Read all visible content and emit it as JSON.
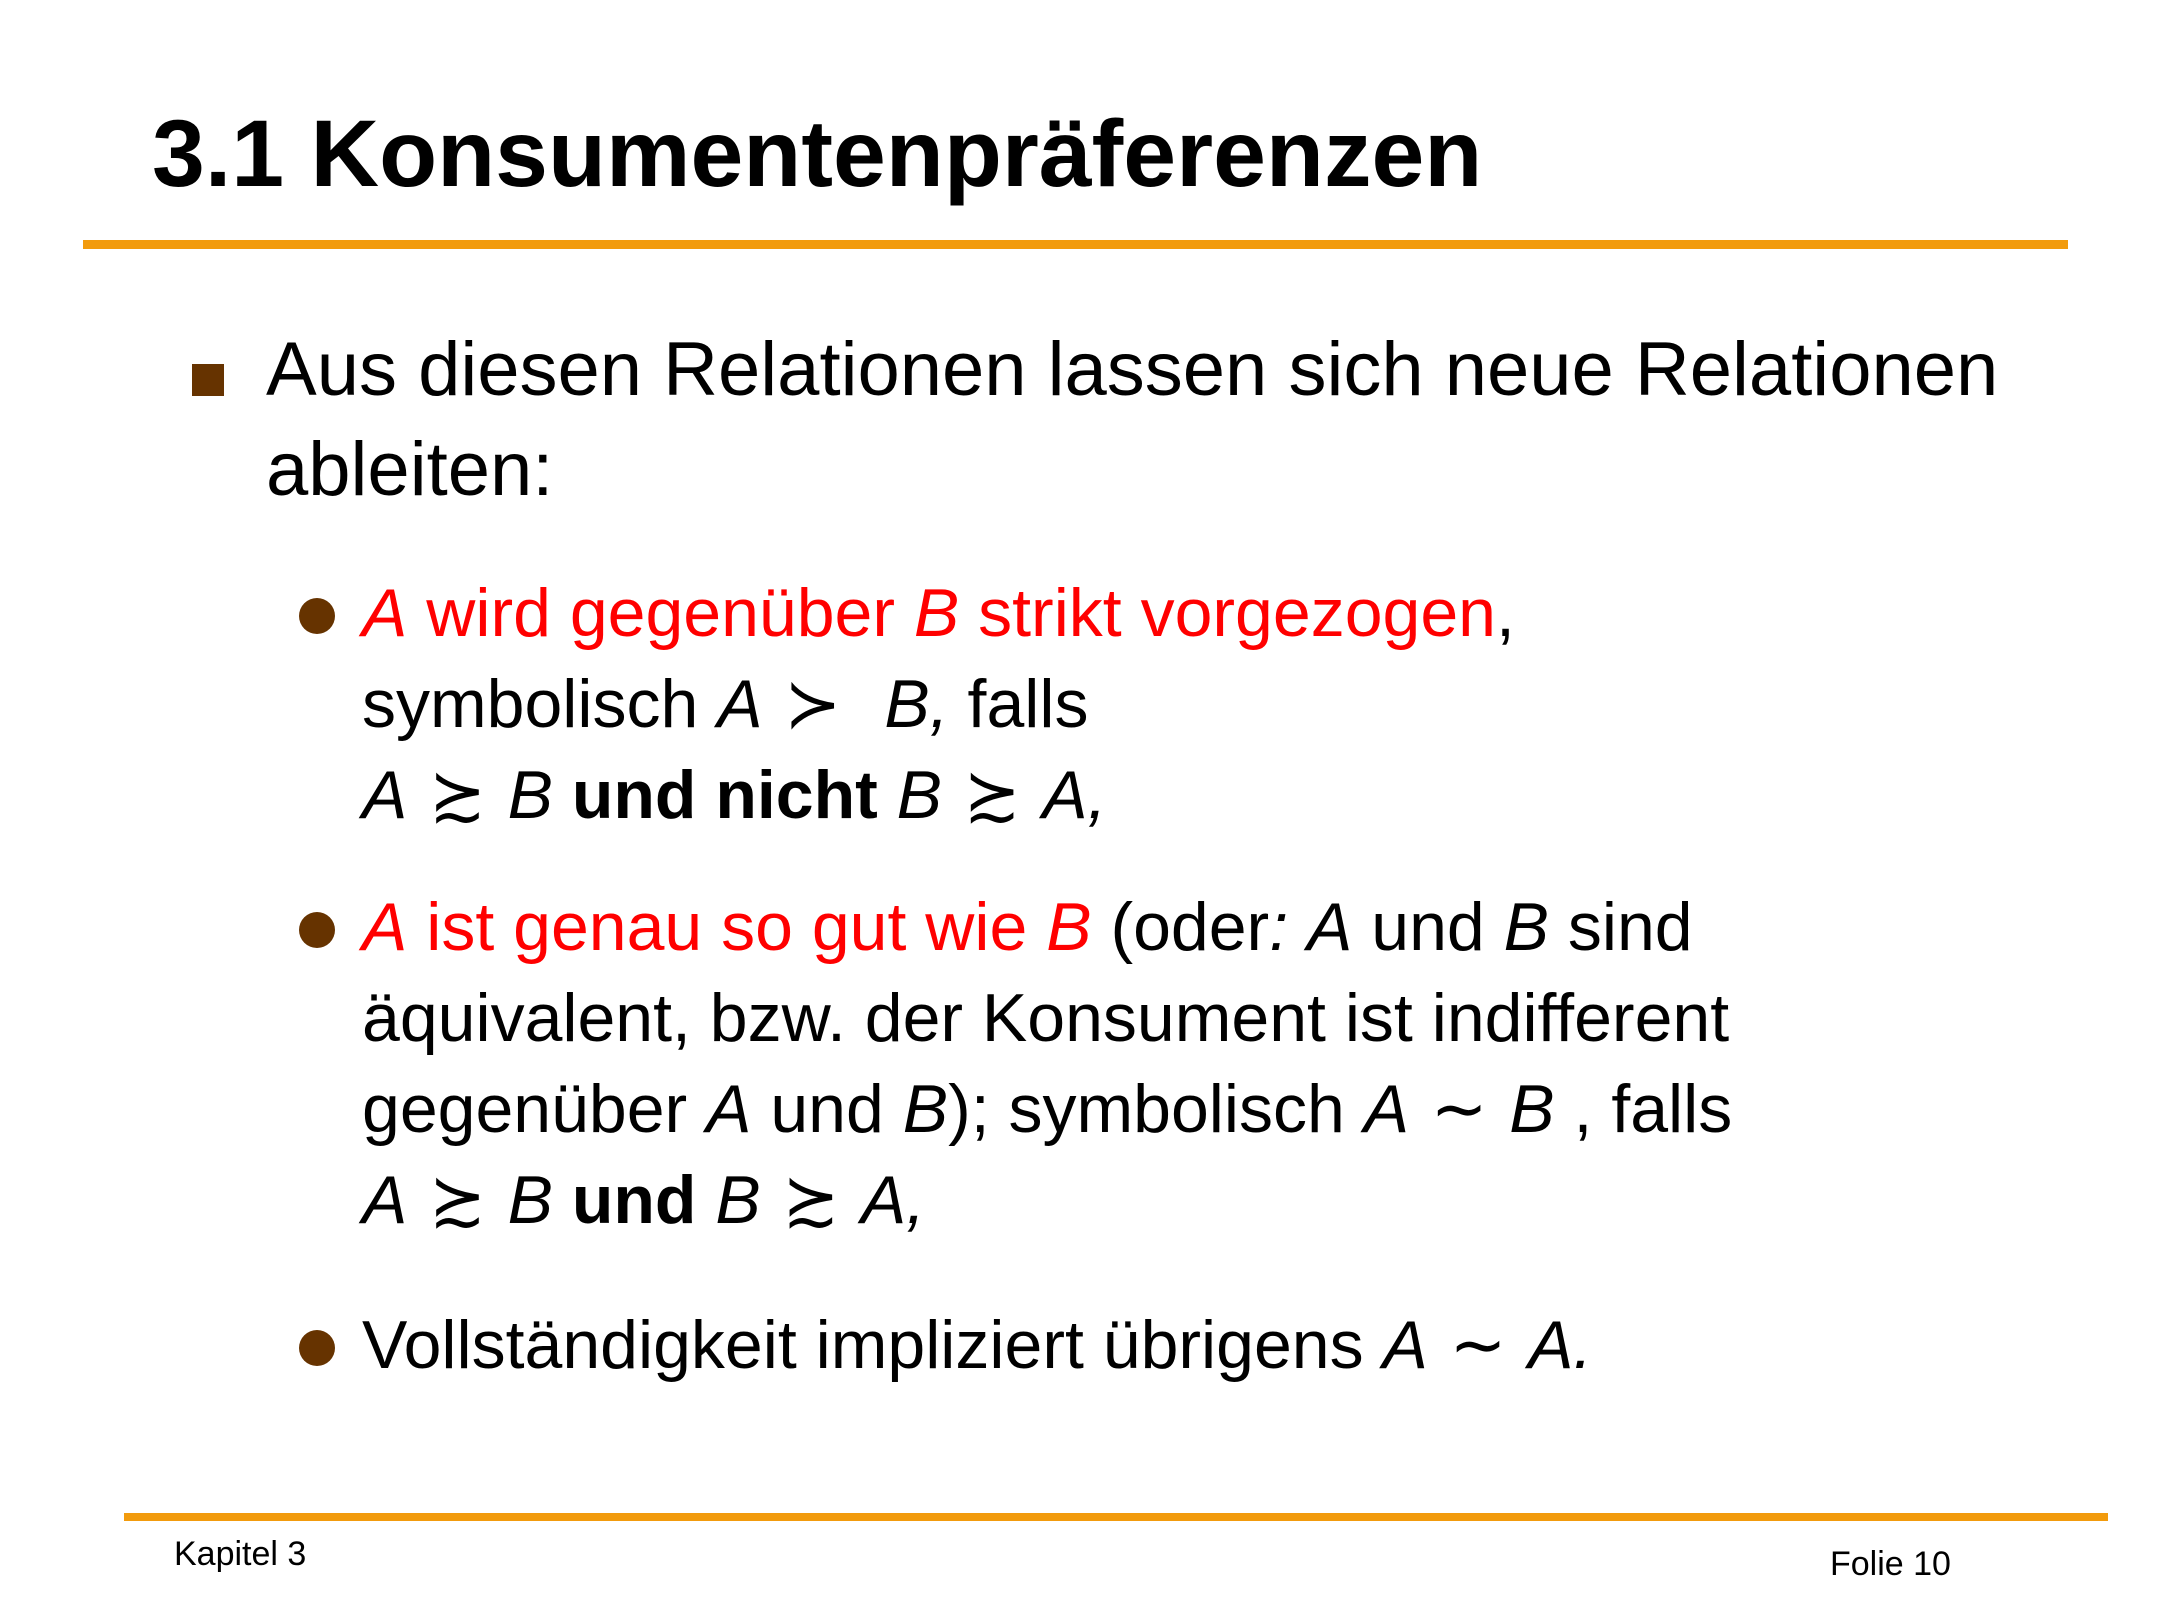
{
  "title": "3.1 Konsumentenpräferenzen",
  "colors": {
    "accent_rule": "#f29b0d",
    "bullet": "#663300",
    "highlight": "#ff0000"
  },
  "main_point": {
    "text": "Aus diesen Relationen lassen sich neue Relationen ableiten:"
  },
  "items": [
    {
      "headline": {
        "A": "A",
        "t1": " wird gegenüber ",
        "B": "B",
        "t2": " strikt vorgezogen",
        "comma": ","
      },
      "line2": {
        "t1": "symbolisch ",
        "A": "A",
        "rel": " ≻  ",
        "B": "B,",
        "t2": " falls"
      },
      "line3": {
        "A": "A",
        "rel1": " ≿ ",
        "B": "B",
        "bold": " und nicht ",
        "B2": "B",
        "rel2": " ≿ ",
        "A2": "A,"
      }
    },
    {
      "headline": {
        "A": "A",
        "t1": " ist genau so gut wie ",
        "B": "B",
        "t2": " (oder",
        "colon": ":",
        "space": " ",
        "A2": "A",
        "t3": " und ",
        "B2": "B",
        "t4": " sind"
      },
      "line2": {
        "text": "äquivalent, bzw. der Konsument ist indifferent"
      },
      "line3": {
        "t1": "gegenüber ",
        "A": "A",
        "t2": " und ",
        "B": "B",
        "t3": "); symbolisch ",
        "A2": "A",
        "rel": " ∼ ",
        "B2": "B",
        "t4": " , falls"
      },
      "line4": {
        "A": "A",
        "rel1": " ≿ ",
        "B": "B",
        "bold": " und ",
        "B2": "B",
        "rel2": " ≿ ",
        "A2": "A,"
      }
    },
    {
      "line1": {
        "t1": "Vollständigkeit impliziert übrigens ",
        "A": "A",
        "rel": " ∼ ",
        "A2": "A."
      }
    }
  ],
  "footer": {
    "chapter": "Kapitel 3",
    "slide": "Folie 10"
  }
}
